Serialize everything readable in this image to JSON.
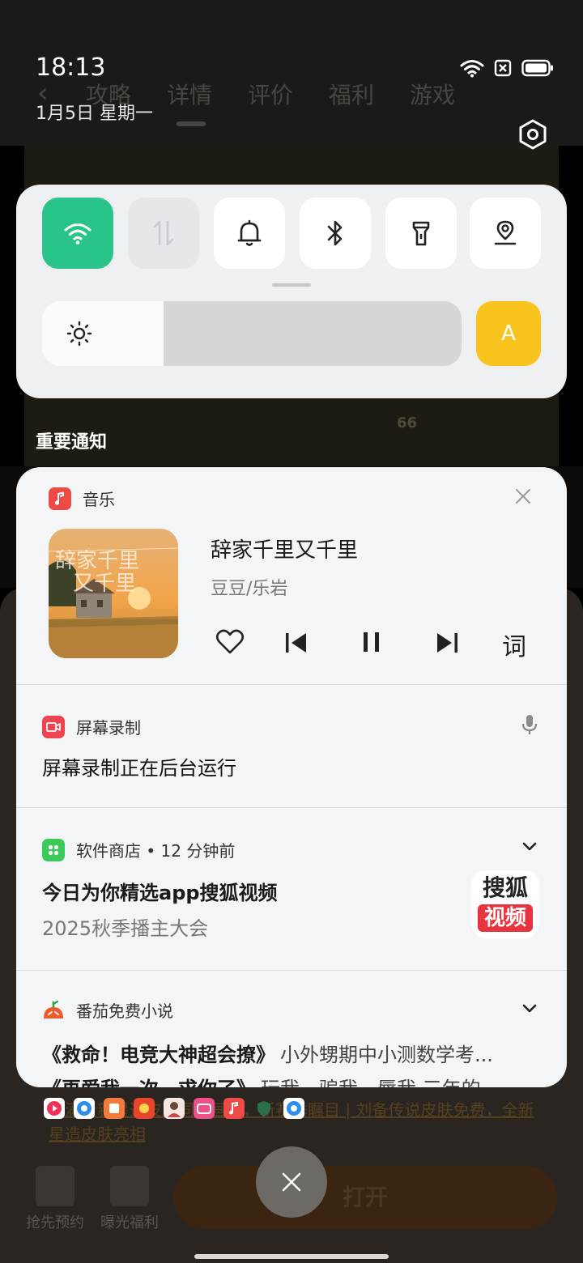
{
  "status_bar": {
    "time": "18:13",
    "date": "1月5日  星期一"
  },
  "background_app": {
    "tabs": [
      "攻略",
      "详情",
      "评价",
      "福利",
      "游戏"
    ],
    "video_stat": "66",
    "promo_text": "打满全新星造皮肤同动画场，新赛季瞩目 | 刘备传说皮肤免费，全新星造皮肤亮相",
    "thumb_captions": [
      "抢先预约",
      "曝光福利"
    ],
    "open_button": "打开"
  },
  "quick_settings": {
    "tiles": [
      {
        "name": "wifi",
        "state": "on"
      },
      {
        "name": "mobile-data",
        "state": "off"
      },
      {
        "name": "bell",
        "state": "normal"
      },
      {
        "name": "bluetooth",
        "state": "normal"
      },
      {
        "name": "flashlight",
        "state": "normal"
      },
      {
        "name": "location",
        "state": "normal"
      }
    ],
    "brightness_level": 0.29,
    "auto_label": "A",
    "accent_color": "#28c489",
    "auto_color": "#f7c31c"
  },
  "notifications": {
    "section_title": "重要通知",
    "music": {
      "app_name": "音乐",
      "song": "辞家千里又千里",
      "artist": "豆豆/乐岩",
      "lyric_label": "词"
    },
    "screen_record": {
      "app_name": "屏幕录制",
      "message": "屏幕录制正在后台运行"
    },
    "app_store": {
      "app_name": "软件商店 • 12 分钟前",
      "title": "今日为你精选app搜狐视频",
      "subtitle": "2025秋季播主大会",
      "logo_top": "搜狐",
      "logo_bottom": "视频"
    },
    "novel": {
      "app_name": "番茄免费小说",
      "items": [
        {
          "title": "《救命！电竞大神超会撩》",
          "desc": "小外甥期中小测数学考..."
        },
        {
          "title": "《再爱我一次，求你了》",
          "desc": "玩我、骗我、辱我,三年的..."
        }
      ]
    }
  }
}
